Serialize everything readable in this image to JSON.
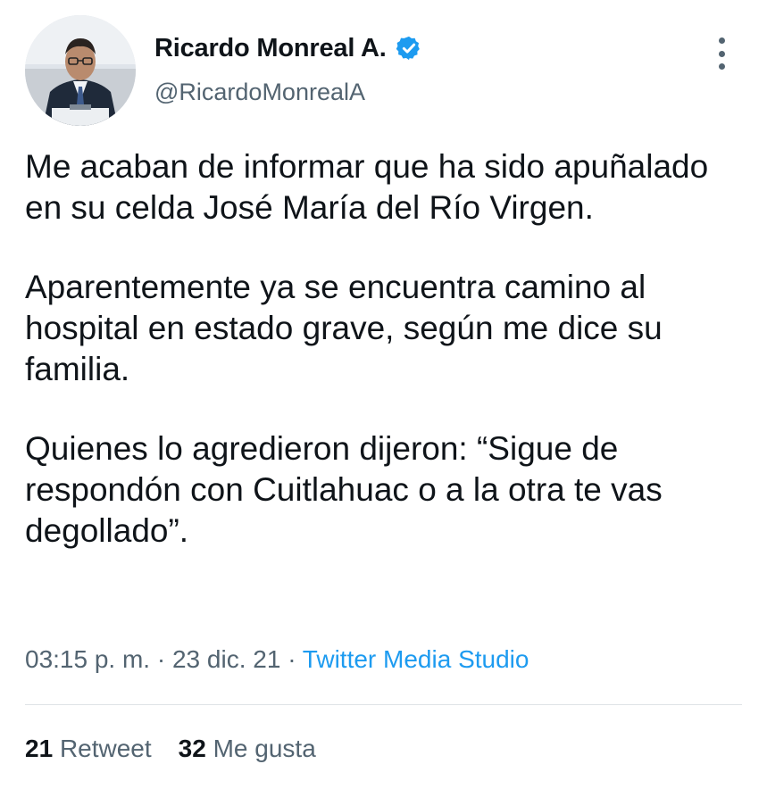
{
  "author": {
    "display_name": "Ricardo Monreal A.",
    "handle": "@RicardoMonrealA",
    "verified": true,
    "avatar_icon": "profile-photo"
  },
  "tweet": {
    "paragraphs": [
      "Me acaban de informar que ha sido apuñalado en su celda José María del Río Virgen.",
      "Aparentemente ya se encuentra camino al hospital en estado grave, según me dice su familia.",
      "Quienes lo agredieron dijeron: “Sigue de respondón con Cuitlahuac o a la otra te vas degollado”."
    ],
    "time": "03:15 p. m.",
    "separator": "·",
    "date": "23 dic. 21",
    "source": "Twitter Media Studio"
  },
  "stats": {
    "retweets_count": "21",
    "retweets_label": "Retweet",
    "likes_count": "32",
    "likes_label": "Me gusta"
  },
  "colors": {
    "text_primary": "#0f1419",
    "text_secondary": "#536471",
    "accent": "#1d9bf0",
    "divider": "#dfe3e6"
  }
}
